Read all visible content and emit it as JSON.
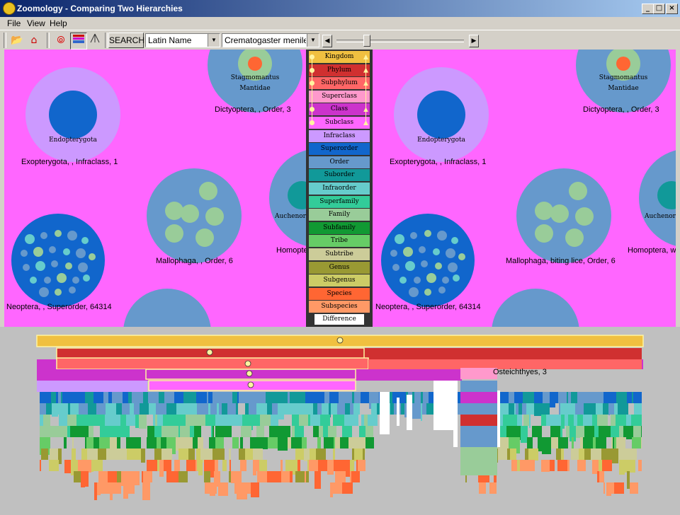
{
  "window": {
    "title": "Zoomology - Comparing Two Hierarchies"
  },
  "menu": {
    "file": "File",
    "view": "View",
    "help": "Help"
  },
  "toolbar": {
    "search_label": "SEARCH",
    "field_select": "Latin Name",
    "search_value": "Crematogaster menilekii"
  },
  "left_panel": {
    "stagmo1": "Stagmomantus",
    "stagmo2": "Mantidae",
    "dict": "Dictyoptera, , Order, 3",
    "endo": "Endopterygota",
    "exo": "Exopterygota, , Infraclass, 1",
    "malloph": "Mallophaga, , Order, 6",
    "auchen": "Auchenorr",
    "homop": "Homopte",
    "neop": "Neoptera, , Superorder, 64314"
  },
  "right_panel": {
    "stagmo1": "Stagmomantus",
    "stagmo2": "Mantidae",
    "dict": "Dictyoptera, , Order, 3",
    "endo": "Endopterygota",
    "exo": "Exopterygota, , Infraclass, 1",
    "malloph": "Mallophaga, biting lice, Order, 6",
    "auchen": "Auchenorr",
    "homop": "Homoptera, wh",
    "neop": "Neoptera, , Superorder, 64314"
  },
  "legend": [
    {
      "label": "Kingdom",
      "color": "#f0c040"
    },
    {
      "label": "Phylum",
      "color": "#d03030"
    },
    {
      "label": "Subphylum",
      "color": "#ff6666"
    },
    {
      "label": "Superclass",
      "color": "#ff99cc"
    },
    {
      "label": "Class",
      "color": "#cc33cc"
    },
    {
      "label": "Subclass",
      "color": "#ff66ff"
    },
    {
      "label": "Infraclass",
      "color": "#cc99ff"
    },
    {
      "label": "Superorder",
      "color": "#1166cc"
    },
    {
      "label": "Order",
      "color": "#6699cc"
    },
    {
      "label": "Suborder",
      "color": "#119999"
    },
    {
      "label": "Infraorder",
      "color": "#66cccc"
    },
    {
      "label": "Superfamily",
      "color": "#33cc99"
    },
    {
      "label": "Family",
      "color": "#99cc99"
    },
    {
      "label": "Subfamily",
      "color": "#119933"
    },
    {
      "label": "Tribe",
      "color": "#66cc66"
    },
    {
      "label": "Subtribe",
      "color": "#cccc99"
    },
    {
      "label": "Genus",
      "color": "#999933"
    },
    {
      "label": "Subgenus",
      "color": "#cccc66"
    },
    {
      "label": "Species",
      "color": "#ff6633"
    },
    {
      "label": "Subspecies",
      "color": "#ff9966"
    },
    {
      "label": "Difference",
      "color": "#ffffff"
    }
  ],
  "bottom": {
    "osteich": "Osteichthyes, 3"
  }
}
